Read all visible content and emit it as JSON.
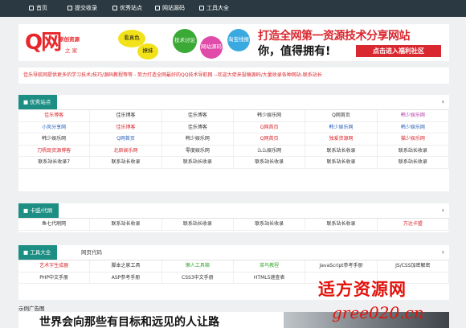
{
  "nav": {
    "items": [
      {
        "label": "首页",
        "icon": "home-icon"
      },
      {
        "label": "提交收录",
        "icon": "submit-icon"
      },
      {
        "label": "优秀站点",
        "icon": "star-icon"
      },
      {
        "label": "网站源码",
        "icon": "code-icon"
      },
      {
        "label": "工具大全",
        "icon": "tools-icon"
      }
    ]
  },
  "banner": {
    "logo_mark": "Q网",
    "logo_line1": "原创资源",
    "logo_line2": "之 家",
    "bubbles": [
      {
        "text": "看真色",
        "color": "#f2e21a"
      },
      {
        "text": "撩妹",
        "color": "#f2e21a"
      },
      {
        "text": "技术讨论",
        "color": "#3aa935"
      },
      {
        "text": "网站源码",
        "color": "#e04aa8"
      },
      {
        "text": "淘宝线报",
        "color": "#3aa9e0"
      }
    ],
    "slogan_line1": "打造全网第一资源技术分享网站",
    "slogan_line2": "你，值得拥有!",
    "cta_label": "点击进入福利社区"
  },
  "announcement": "佳乐导航网提供更多的学习技术/技巧/源码教程等等 - 努力打造全网最好的QQ技术导航网 --欢迎大佬来投稿源码/大量收录各种网站-联系站长",
  "sections": {
    "excellent": {
      "title": "优秀站点",
      "links": [
        {
          "t": "佳乐博客",
          "c": "#d9282f"
        },
        {
          "t": "佳乐博客",
          "c": "#333"
        },
        {
          "t": "佳乐博客",
          "c": "#333"
        },
        {
          "t": "韩少娱乐网",
          "c": "#333"
        },
        {
          "t": "Q网首页",
          "c": "#333"
        },
        {
          "t": "韩少娱乐网",
          "c": "#b23aa9"
        },
        {
          "t": "小风分享网",
          "c": "#2a62b8"
        },
        {
          "t": "佳乐博客",
          "c": "#d9282f"
        },
        {
          "t": "佳乐博客",
          "c": "#333"
        },
        {
          "t": "Q网首页",
          "c": "#d9282f"
        },
        {
          "t": "韩少娱乐网",
          "c": "#2a62b8"
        },
        {
          "t": "韩少娱乐网",
          "c": "#2a62b8"
        },
        {
          "t": "韩少娱乐网",
          "c": "#333"
        },
        {
          "t": "Q网首页",
          "c": "#2a62b8"
        },
        {
          "t": "韩少娱乐网",
          "c": "#333"
        },
        {
          "t": "Q网首页",
          "c": "#d9282f"
        },
        {
          "t": "独爱资源网",
          "c": "#d9282f"
        },
        {
          "t": "猫少娱乐网",
          "c": "#d9282f"
        },
        {
          "t": "刀帆既资源博客",
          "c": "#d9282f"
        },
        {
          "t": "北辰娱乐网",
          "c": "#d9282f"
        },
        {
          "t": "零度娱乐网",
          "c": "#333"
        },
        {
          "t": "么么娱乐网",
          "c": "#333"
        },
        {
          "t": "联系站长收录",
          "c": "#333"
        },
        {
          "t": "联系站长收录",
          "c": "#333"
        },
        {
          "t": "联系站长收录7",
          "c": "#333"
        },
        {
          "t": "联系站长收录",
          "c": "#333"
        },
        {
          "t": "联系站长收录",
          "c": "#333"
        },
        {
          "t": "联系站长收录",
          "c": "#333"
        },
        {
          "t": "联系站长收录",
          "c": "#333"
        },
        {
          "t": "联系站长收录",
          "c": "#333"
        }
      ]
    },
    "cards": {
      "title": "卡盟/代刷",
      "links": [
        {
          "t": "鱼七代刷网",
          "c": "#333"
        },
        {
          "t": "联系站长收录",
          "c": "#333"
        },
        {
          "t": "联系站长收录",
          "c": "#333"
        },
        {
          "t": "联系站长收录",
          "c": "#333"
        },
        {
          "t": "联系站长收录",
          "c": "#333"
        },
        {
          "t": "万达卡盟",
          "c": "#d9282f"
        }
      ]
    },
    "tools": {
      "title": "工具大全",
      "tab": "网页代码",
      "links": [
        {
          "t": "艺术字生成器",
          "c": "#d9282f"
        },
        {
          "t": "脚本之家工具",
          "c": "#333"
        },
        {
          "t": "懒人工具箱",
          "c": "#3aa935"
        },
        {
          "t": "菜鸟教程",
          "c": "#3aa935"
        },
        {
          "t": "JavaScript参考手册",
          "c": "#333"
        },
        {
          "t": "JS/CSS加密解密",
          "c": "#333"
        },
        {
          "t": "PHP中文手册",
          "c": "#333"
        },
        {
          "t": "ASP参考手册",
          "c": "#333"
        },
        {
          "t": "CSS3中文手册",
          "c": "#333"
        },
        {
          "t": "HTML5速查表",
          "c": "#333"
        },
        {
          "t": "",
          "c": "#333"
        },
        {
          "t": "",
          "c": "#333"
        }
      ]
    }
  },
  "ad": {
    "tag": "示例广告图",
    "headline": "世界会向那些有目标和远见的人让路"
  },
  "watermark": {
    "line1": "适方资源网",
    "line2": "gree020.cn"
  }
}
